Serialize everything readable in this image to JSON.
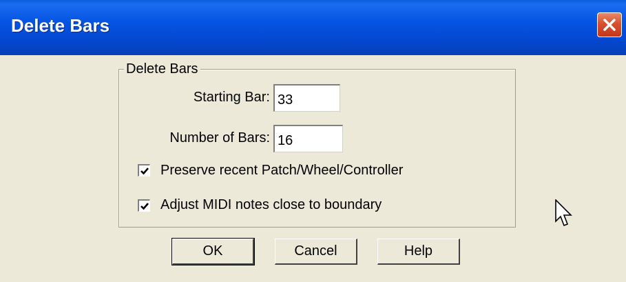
{
  "window": {
    "title": "Delete Bars"
  },
  "group": {
    "label": "Delete Bars",
    "starting_bar_label": "Starting Bar:",
    "starting_bar_value": "33",
    "number_of_bars_label": "Number of Bars:",
    "number_of_bars_value": "16",
    "checkbox_preserve_label": "Preserve recent Patch/Wheel/Controller",
    "checkbox_preserve_checked": true,
    "checkbox_adjust_label": "Adjust MIDI notes close to boundary",
    "checkbox_adjust_checked": true
  },
  "buttons": {
    "ok": "OK",
    "cancel": "Cancel",
    "help": "Help"
  },
  "icons": {
    "close": "close-icon",
    "check": "check-icon",
    "cursor": "mouse-pointer-icon"
  }
}
